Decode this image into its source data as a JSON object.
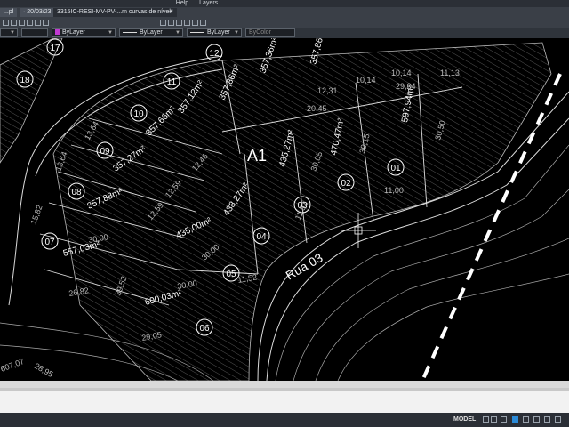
{
  "app": {
    "menu_items": [
      "...",
      "Help",
      "Layers"
    ]
  },
  "tabs": [
    {
      "label": "...pl"
    },
    {
      "label": "· 20/03/23"
    },
    {
      "label": "3315IC-RESI-MV-PV-...m curvas de nível*"
    },
    {
      "label": "+"
    }
  ],
  "properties": {
    "layer_value": "ByLayer",
    "linetype_value": "ByLayer",
    "lineweight_value": "ByLayer",
    "plotstyle_value": "ByColor",
    "layer_color": "#c03ad1"
  },
  "drawing": {
    "block_label": "A1",
    "street_label": "Rua 03",
    "lots": [
      {
        "id": "01",
        "area": "597,94m²"
      },
      {
        "id": "02",
        "area": "470,47m²"
      },
      {
        "id": "03",
        "area": "435,27m²"
      },
      {
        "id": "04",
        "area": "438,27m²"
      },
      {
        "id": "05",
        "area": "435,00m²"
      },
      {
        "id": "06",
        "area": "600,03m²"
      },
      {
        "id": "07",
        "area": "557,03m²"
      },
      {
        "id": "08",
        "area": "357,88m²"
      },
      {
        "id": "09",
        "area": "357,27m²"
      },
      {
        "id": "10",
        "area": "357,66m²"
      },
      {
        "id": "11",
        "area": "357,12m²"
      },
      {
        "id": "12",
        "area": "357,86m²"
      },
      {
        "id": "17",
        "area": ""
      },
      {
        "id": "18",
        "area": ""
      }
    ],
    "extra_areas": [
      "357,36m²",
      "357,86m²",
      "597,94m²"
    ],
    "dimensions": [
      "10,14",
      "11,13",
      "29,24",
      "12,31",
      "10,14",
      "20,45",
      "30,50",
      "11,00",
      "30,15",
      "30,05",
      "11,52",
      "11,52",
      "30,00",
      "30,00",
      "39,52",
      "29,05",
      "15,82",
      "13,64",
      "13,64",
      "12,46",
      "12,59",
      "12,59",
      "30,00",
      "26,82",
      "28,95",
      "607,07"
    ]
  },
  "status": {
    "model_label": "MODEL"
  }
}
